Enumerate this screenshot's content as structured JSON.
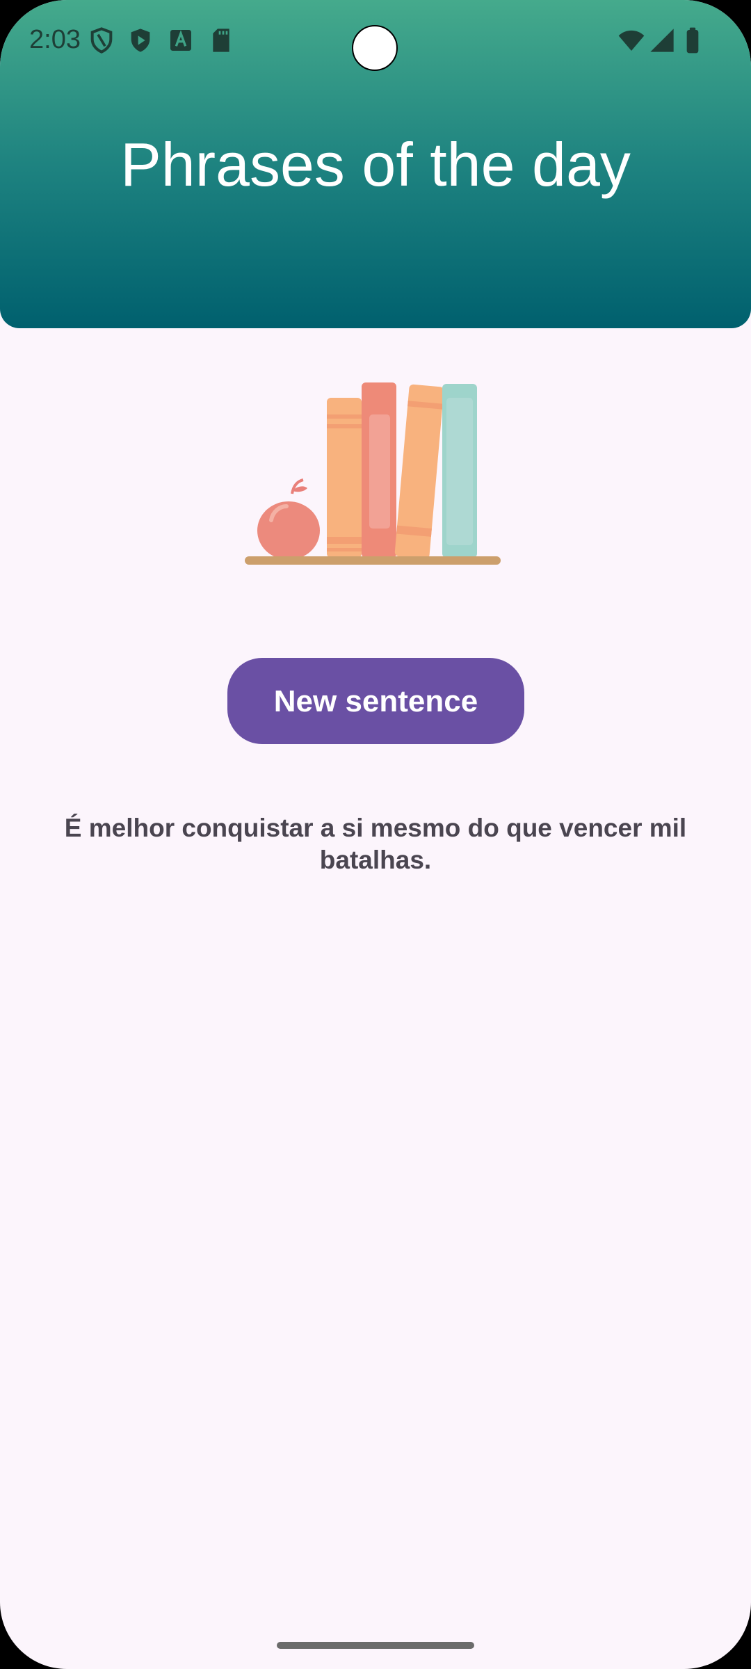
{
  "status_bar": {
    "time": "2:03",
    "icons": [
      "shield-icon",
      "play-shield-icon",
      "font-a-icon",
      "sd-card-icon",
      "wifi-icon",
      "cell-signal-icon",
      "battery-icon"
    ]
  },
  "header": {
    "title": "Phrases of the day"
  },
  "illustration": {
    "name": "books-and-apple-illustration"
  },
  "main": {
    "button_label": "New sentence",
    "quote": "É melhor conquistar a si mesmo do que vencer mil batalhas."
  },
  "colors": {
    "header_top": "#45AA8C",
    "header_bottom": "#00606E",
    "background": "#FCF5FC",
    "button": "#6A50A4",
    "quote_text": "#4A4550"
  }
}
